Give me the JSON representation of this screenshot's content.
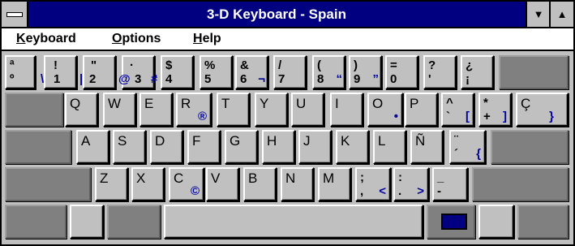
{
  "window": {
    "title": "3-D Keyboard - Spain"
  },
  "titlebar": {
    "minimize_glyph": "▼",
    "maximize_glyph": "▲",
    "system_menu_icon": "system-menu-icon"
  },
  "menu": [
    {
      "access": "K",
      "rest": "eyboard"
    },
    {
      "access": "O",
      "rest": "ptions"
    },
    {
      "access": "H",
      "rest": "elp"
    }
  ],
  "colors": {
    "title_bg": "#000080",
    "key_face": "#c0c0c0",
    "key_dark": "#808080",
    "alt_glyph": "#0000a0"
  },
  "keys": {
    "row1": [
      {
        "top": "ª",
        "bottom": "º"
      },
      {
        "top": "!",
        "bottom": "1",
        "alt": "\\"
      },
      {
        "top": "\"",
        "bottom": "2",
        "alt": "|"
      },
      {
        "top": "·",
        "bottom": "3",
        "alt": "@"
      },
      {
        "top": "$",
        "bottom": "4",
        "alt": "#"
      },
      {
        "top": "%",
        "bottom": "5"
      },
      {
        "top": "&",
        "bottom": "6",
        "alt": "¬"
      },
      {
        "top": "/",
        "bottom": "7"
      },
      {
        "top": "(",
        "bottom": "8"
      },
      {
        "top": ")",
        "bottom": "9",
        "alt": "“"
      },
      {
        "top": "=",
        "bottom": "0",
        "alt": "”"
      },
      {
        "top": "?",
        "bottom": "'"
      },
      {
        "top": "¿",
        "bottom": "¡"
      }
    ],
    "row2": [
      {
        "main": "Q"
      },
      {
        "main": "W"
      },
      {
        "main": "E"
      },
      {
        "main": "R",
        "alt": "®"
      },
      {
        "main": "T"
      },
      {
        "main": "Y"
      },
      {
        "main": "U"
      },
      {
        "main": "I"
      },
      {
        "main": "O",
        "alt": "•"
      },
      {
        "main": "P"
      },
      {
        "top": "^",
        "bottom": "`",
        "alt": "["
      },
      {
        "top": "*",
        "bottom": "+",
        "alt": "]"
      },
      {
        "main": "Ç",
        "alt": "}"
      }
    ],
    "row3": [
      {
        "main": "A"
      },
      {
        "main": "S"
      },
      {
        "main": "D"
      },
      {
        "main": "F"
      },
      {
        "main": "G"
      },
      {
        "main": "H"
      },
      {
        "main": "J"
      },
      {
        "main": "K"
      },
      {
        "main": "L"
      },
      {
        "main": "Ñ"
      },
      {
        "top": "¨",
        "bottom": "´",
        "alt": "{"
      }
    ],
    "row4": [
      {
        "main": "Z"
      },
      {
        "main": "X"
      },
      {
        "main": "C",
        "alt": "©"
      },
      {
        "main": "V"
      },
      {
        "main": "B"
      },
      {
        "main": "N"
      },
      {
        "main": "M"
      },
      {
        "top": ";",
        "bottom": ",",
        "alt": "<"
      },
      {
        "top": ":",
        "bottom": ".",
        "alt": ">"
      },
      {
        "top": "_",
        "bottom": "-"
      }
    ]
  }
}
